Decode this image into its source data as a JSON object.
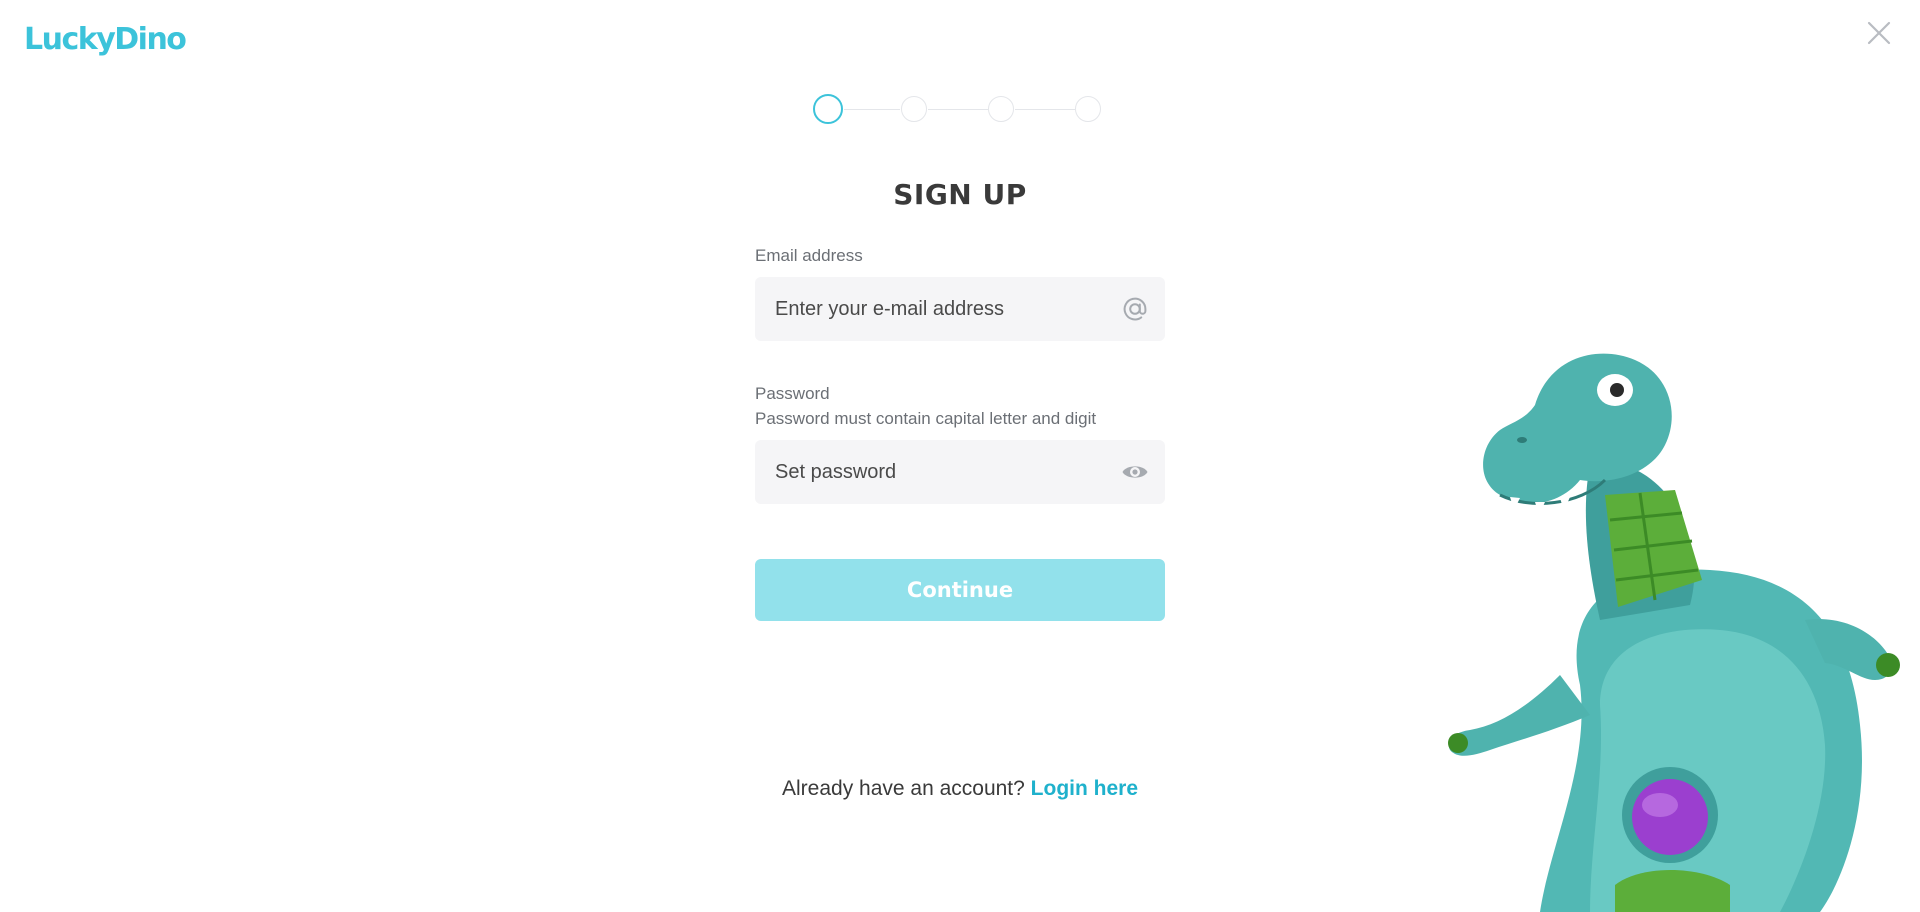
{
  "brand": {
    "logo_text": "LuckyDino",
    "accent_color": "#3cc3da"
  },
  "header": {
    "close_icon": "close-icon"
  },
  "stepper": {
    "current_step": 1,
    "total_steps": 4
  },
  "form": {
    "title": "SIGN UP",
    "email": {
      "label": "Email address",
      "placeholder": "Enter your e-mail address",
      "value": "",
      "icon": "at-sign-icon"
    },
    "password": {
      "label": "Password",
      "hint": "Password must contain capital letter and digit",
      "placeholder": "Set password",
      "value": "",
      "icon": "eye-icon"
    },
    "continue_label": "Continue",
    "continue_color": "#92e1eb"
  },
  "footer": {
    "prompt": "Already have an account?",
    "login_label": "Login here"
  },
  "illustration": {
    "name": "dino-mascot"
  }
}
